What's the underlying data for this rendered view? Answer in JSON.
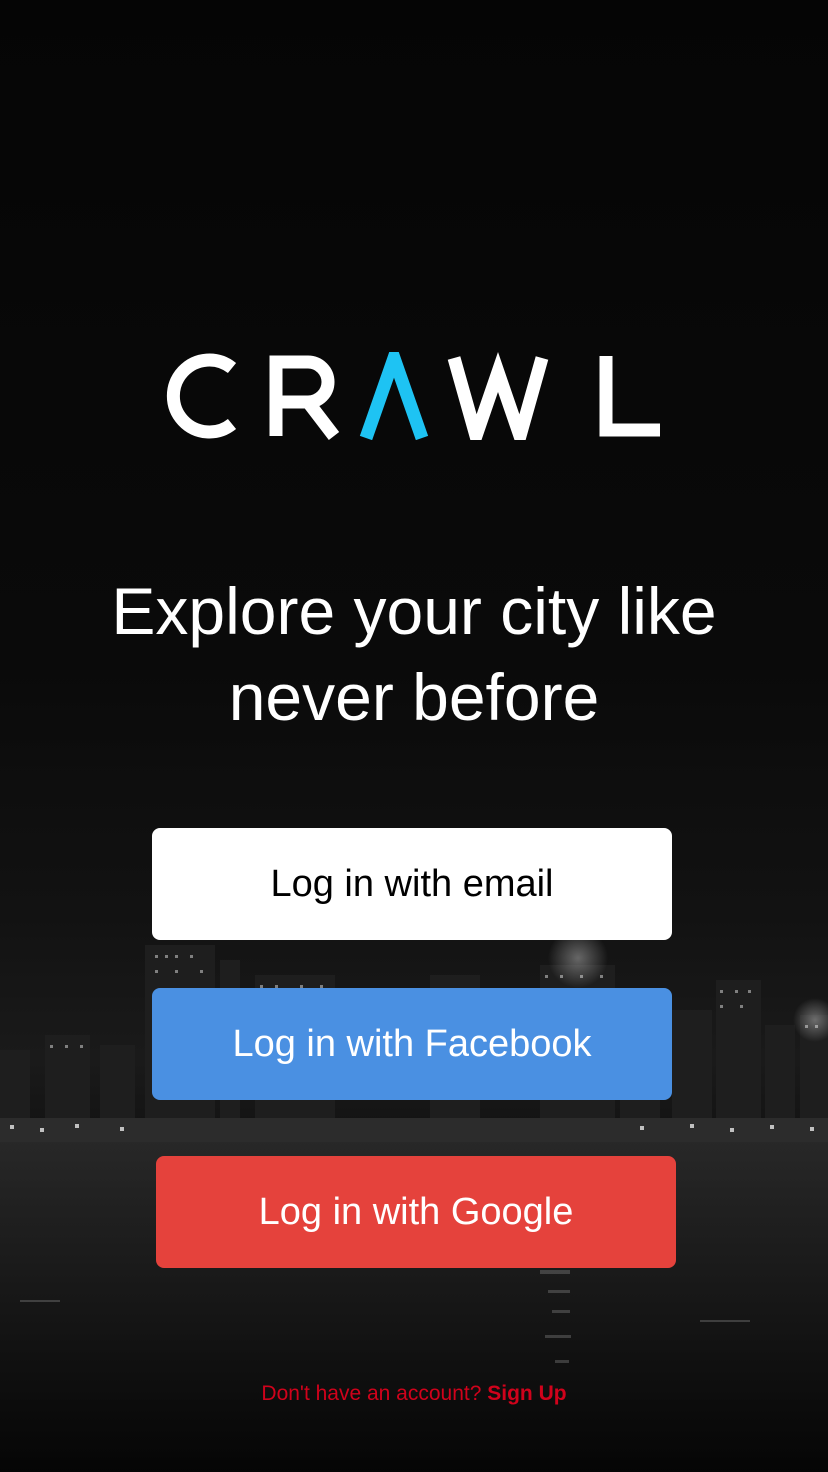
{
  "app": {
    "logo_text": "CRAWL",
    "accent_color": "#1ec3f3"
  },
  "tagline": {
    "line1": "Explore your city like",
    "line2": "never before"
  },
  "buttons": {
    "email_label": "Log in with email",
    "facebook_label": "Log in with Facebook",
    "google_label": "Log in with Google"
  },
  "signup": {
    "prompt": "Don't have an account?",
    "link_label": "Sign Up"
  },
  "colors": {
    "background": "#000000",
    "facebook": "#4a90e2",
    "google": "#e5423c",
    "signup_text": "#d0021b"
  }
}
